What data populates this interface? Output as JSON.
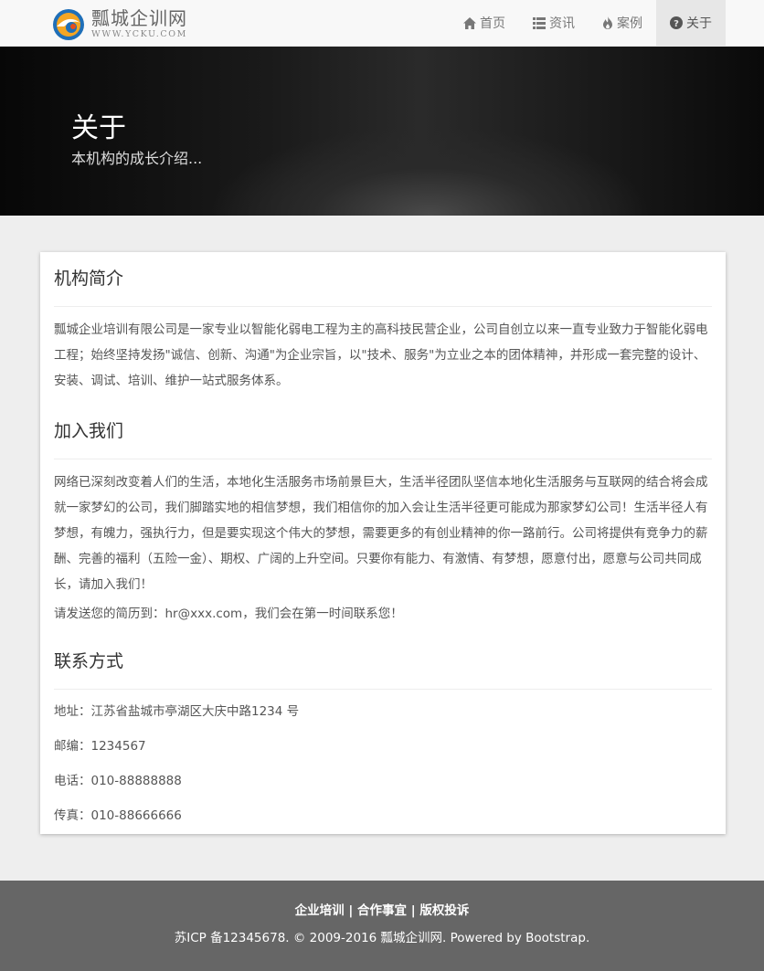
{
  "brand": {
    "name": "瓢城企训网",
    "url": "WWW.YCKU.COM"
  },
  "nav": [
    {
      "label": "首页",
      "icon": "home-icon"
    },
    {
      "label": "资讯",
      "icon": "list-icon"
    },
    {
      "label": "案例",
      "icon": "fire-icon"
    },
    {
      "label": "关于",
      "icon": "question-circle-icon",
      "active": true
    }
  ],
  "hero": {
    "title": "关于",
    "subtitle": "本机构的成长介绍..."
  },
  "sections": {
    "intro": {
      "title": "机构简介",
      "text": "瓢城企业培训有限公司是一家专业以智能化弱电工程为主的高科技民营企业，公司自创立以来一直专业致力于智能化弱电工程；始终坚持发扬\"诚信、创新、沟通\"为企业宗旨，以\"技术、服务\"为立业之本的团体精神，并形成一套完整的设计、安装、调试、培训、维护一站式服务体系。"
    },
    "join": {
      "title": "加入我们",
      "text": "网络已深刻改变着人们的生活，本地化生活服务市场前景巨大，生活半径团队坚信本地化生活服务与互联网的结合将会成就一家梦幻的公司，我们脚踏实地的相信梦想，我们相信你的加入会让生活半径更可能成为那家梦幻公司！生活半径人有梦想，有魄力，强执行力，但是要实现这个伟大的梦想，需要更多的有创业精神的你一路前行。公司将提供有竞争力的薪酬、完善的福利（五险一金）、期权、广阔的上升空间。只要你有能力、有激情、有梦想，愿意付出，愿意与公司共同成长，请加入我们！",
      "resume": "请发送您的简历到：hr@xxx.com，我们会在第一时间联系您！"
    },
    "contact": {
      "title": "联系方式",
      "address": "地址：江苏省盐城市亭湖区大庆中路1234 号",
      "postcode": "邮编：1234567",
      "phone": "电话：010-88888888",
      "fax": "传真：010-88666666"
    }
  },
  "footer": {
    "links": [
      "企业培训",
      "合作事宜",
      "版权投诉"
    ],
    "separator": "|",
    "copyright": "苏ICP 备12345678. © 2009-2016 瓢城企训网. Powered by Bootstrap."
  },
  "colors": {
    "navbar_bg": "#f8f8f8",
    "active_nav_bg": "#e7e7e7",
    "footer_bg": "#666666",
    "page_bg": "#eeeeee"
  }
}
